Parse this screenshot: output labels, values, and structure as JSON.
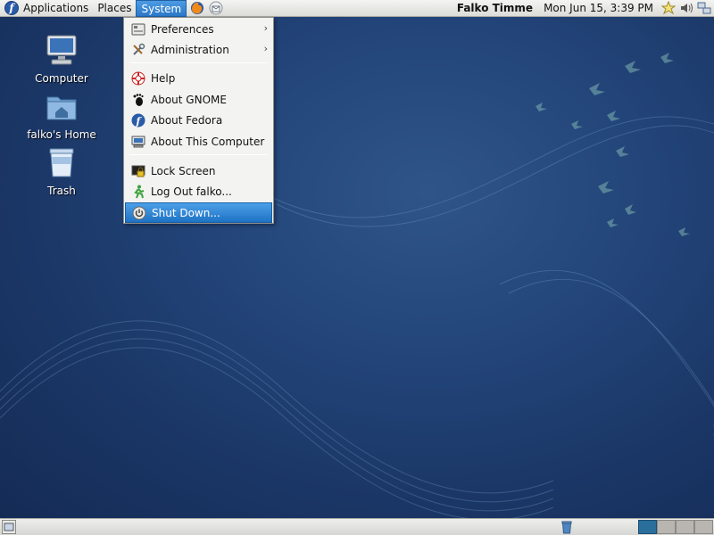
{
  "top_panel": {
    "menus": {
      "applications": "Applications",
      "places": "Places",
      "system": "System"
    },
    "launchers": [
      "firefox-icon",
      "mail-client-icon"
    ],
    "user": "Falko Timme",
    "clock": "Mon Jun 15,  3:39 PM",
    "tray": [
      "update-star-icon",
      "volume-icon",
      "network-icon"
    ]
  },
  "desktop_icons": [
    {
      "label": "Computer",
      "icon": "computer-icon"
    },
    {
      "label": "falko's Home",
      "icon": "home-folder-icon"
    },
    {
      "label": "Trash",
      "icon": "trash-icon"
    }
  ],
  "system_menu": {
    "items": [
      {
        "label": "Preferences",
        "icon": "preferences-icon",
        "submenu": true
      },
      {
        "label": "Administration",
        "icon": "administration-icon",
        "submenu": true
      },
      {
        "label": "Help",
        "icon": "help-icon"
      },
      {
        "label": "About GNOME",
        "icon": "gnome-foot-icon"
      },
      {
        "label": "About Fedora",
        "icon": "fedora-icon"
      },
      {
        "label": "About This Computer",
        "icon": "computer-icon"
      },
      {
        "label": "Lock Screen",
        "icon": "lock-screen-icon"
      },
      {
        "label": "Log Out falko...",
        "icon": "log-out-icon"
      },
      {
        "label": "Shut Down...",
        "icon": "shutdown-icon",
        "highlighted": true
      }
    ],
    "submenu_arrow": "›"
  },
  "bottom_panel": {
    "workspaces": 4,
    "active_workspace": 1
  },
  "colors": {
    "accent": "#2b78c8",
    "desktop": "#23457a"
  }
}
